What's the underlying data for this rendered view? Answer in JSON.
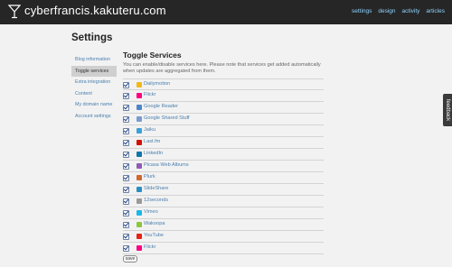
{
  "header": {
    "site_title": "cyberfrancis.kakuteru.com",
    "nav": [
      "settings",
      "design",
      "activity",
      "articles"
    ]
  },
  "page_title": "Settings",
  "sidebar": {
    "items": [
      {
        "label": "Blog information",
        "active": false
      },
      {
        "label": "Toggle services",
        "active": true
      },
      {
        "label": "Extra integration",
        "active": false
      },
      {
        "label": "Content",
        "active": false
      },
      {
        "label": "My domain name",
        "active": false
      },
      {
        "label": "Account settings",
        "active": false
      }
    ]
  },
  "main": {
    "title": "Toggle Services",
    "description": "You can enable/disable services here. Please note that services get added automatically when updates are aggregated from them.",
    "services": [
      {
        "name": "Dailymotion",
        "icon": "dailymotion-icon",
        "color": "#f2b81b",
        "checked": true
      },
      {
        "name": "Flickr",
        "icon": "flickr-icon",
        "color": "#ff0084",
        "checked": true
      },
      {
        "name": "Google Reader",
        "icon": "google-reader-icon",
        "color": "#4b86c9",
        "checked": true
      },
      {
        "name": "Google Shared Stuff",
        "icon": "google-shared-icon",
        "color": "#7a9ccf",
        "checked": true
      },
      {
        "name": "Jaiku",
        "icon": "jaiku-icon",
        "color": "#3aa0d8",
        "checked": true
      },
      {
        "name": "Last.fm",
        "icon": "lastfm-icon",
        "color": "#d51007",
        "checked": true
      },
      {
        "name": "LinkedIn",
        "icon": "linkedin-icon",
        "color": "#0e76a8",
        "checked": true
      },
      {
        "name": "Picasa Web Albums",
        "icon": "picasa-icon",
        "color": "#8e5bb5",
        "checked": true
      },
      {
        "name": "Plurk",
        "icon": "plurk-icon",
        "color": "#cf682f",
        "checked": true
      },
      {
        "name": "SlideShare",
        "icon": "slideshare-icon",
        "color": "#2a8ec3",
        "checked": true
      },
      {
        "name": "12seconds",
        "icon": "12seconds-icon",
        "color": "#9a9a9a",
        "checked": true
      },
      {
        "name": "Vimeo",
        "icon": "vimeo-icon",
        "color": "#1ab7ea",
        "checked": true
      },
      {
        "name": "Wakoopa",
        "icon": "wakoopa-icon",
        "color": "#8cc63f",
        "checked": true
      },
      {
        "name": "YouTube",
        "icon": "youtube-icon",
        "color": "#e62117",
        "checked": true
      },
      {
        "name": "Flickr",
        "icon": "flickr-icon",
        "color": "#ff0084",
        "checked": true
      }
    ],
    "save_label": "save"
  },
  "feedback_label": "feedback",
  "colors": {
    "header_bg": "#262626",
    "nav_link": "#8fd4ff",
    "link": "#4a7fae",
    "active_sidebar_bg": "#cfcfcf"
  }
}
